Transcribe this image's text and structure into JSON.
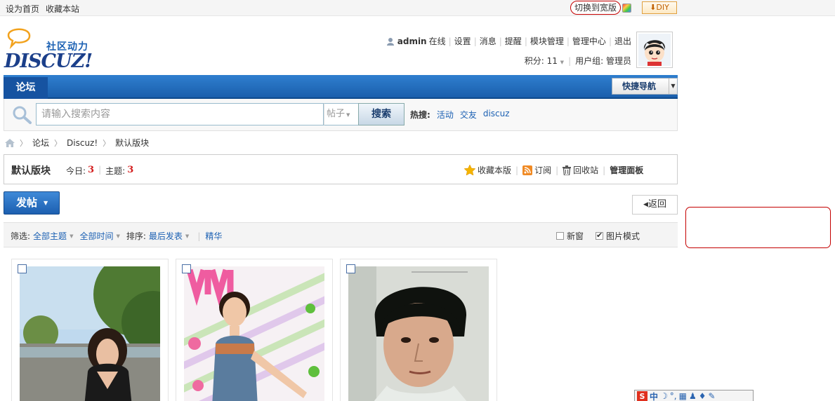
{
  "topbar": {
    "set_home": "设为首页",
    "bookmark_site": "收藏本站",
    "switch_wide": "切换到宽版",
    "diy": "DIY"
  },
  "logo": {
    "slogan": "社区动力",
    "word": "DISCUZ!"
  },
  "user": {
    "name": "admin",
    "status": "在线",
    "menu": [
      "设置",
      "消息",
      "提醒",
      "模块管理",
      "管理中心",
      "退出"
    ],
    "points_label": "积分:",
    "points_value": "11",
    "group_label": "用户组:",
    "group_value": "管理员"
  },
  "nav": {
    "forum_tab": "论坛",
    "quick_nav": "快捷导航"
  },
  "search": {
    "placeholder": "请输入搜索内容",
    "type": "帖子",
    "button": "搜索",
    "hot_label": "热搜:",
    "hot_terms": [
      "活动",
      "交友",
      "discuz"
    ]
  },
  "breadcrumb": [
    "论坛",
    "Discuz!",
    "默认版块"
  ],
  "forum": {
    "title": "默认版块",
    "today_label": "今日:",
    "today_value": "3",
    "threads_label": "主题:",
    "threads_value": "3",
    "favorite": "收藏本版",
    "subscribe": "订阅",
    "recycle": "回收站",
    "admin_panel": "管理面板"
  },
  "actions": {
    "post": "发帖",
    "back": "返回"
  },
  "filter": {
    "filter_label": "筛选:",
    "all_threads": "全部主题",
    "all_time": "全部时间",
    "sort_label": "排序:",
    "last_post": "最后发表",
    "digest": "精华",
    "new_window": "新窗",
    "pic_mode": "图片模式"
  },
  "ime": {
    "label": "中"
  },
  "colors": {
    "link": "#1c61b3",
    "nav_blue": "#1a5fac",
    "highlight_red": "#d31c1c",
    "annotation_red": "#c40000"
  }
}
